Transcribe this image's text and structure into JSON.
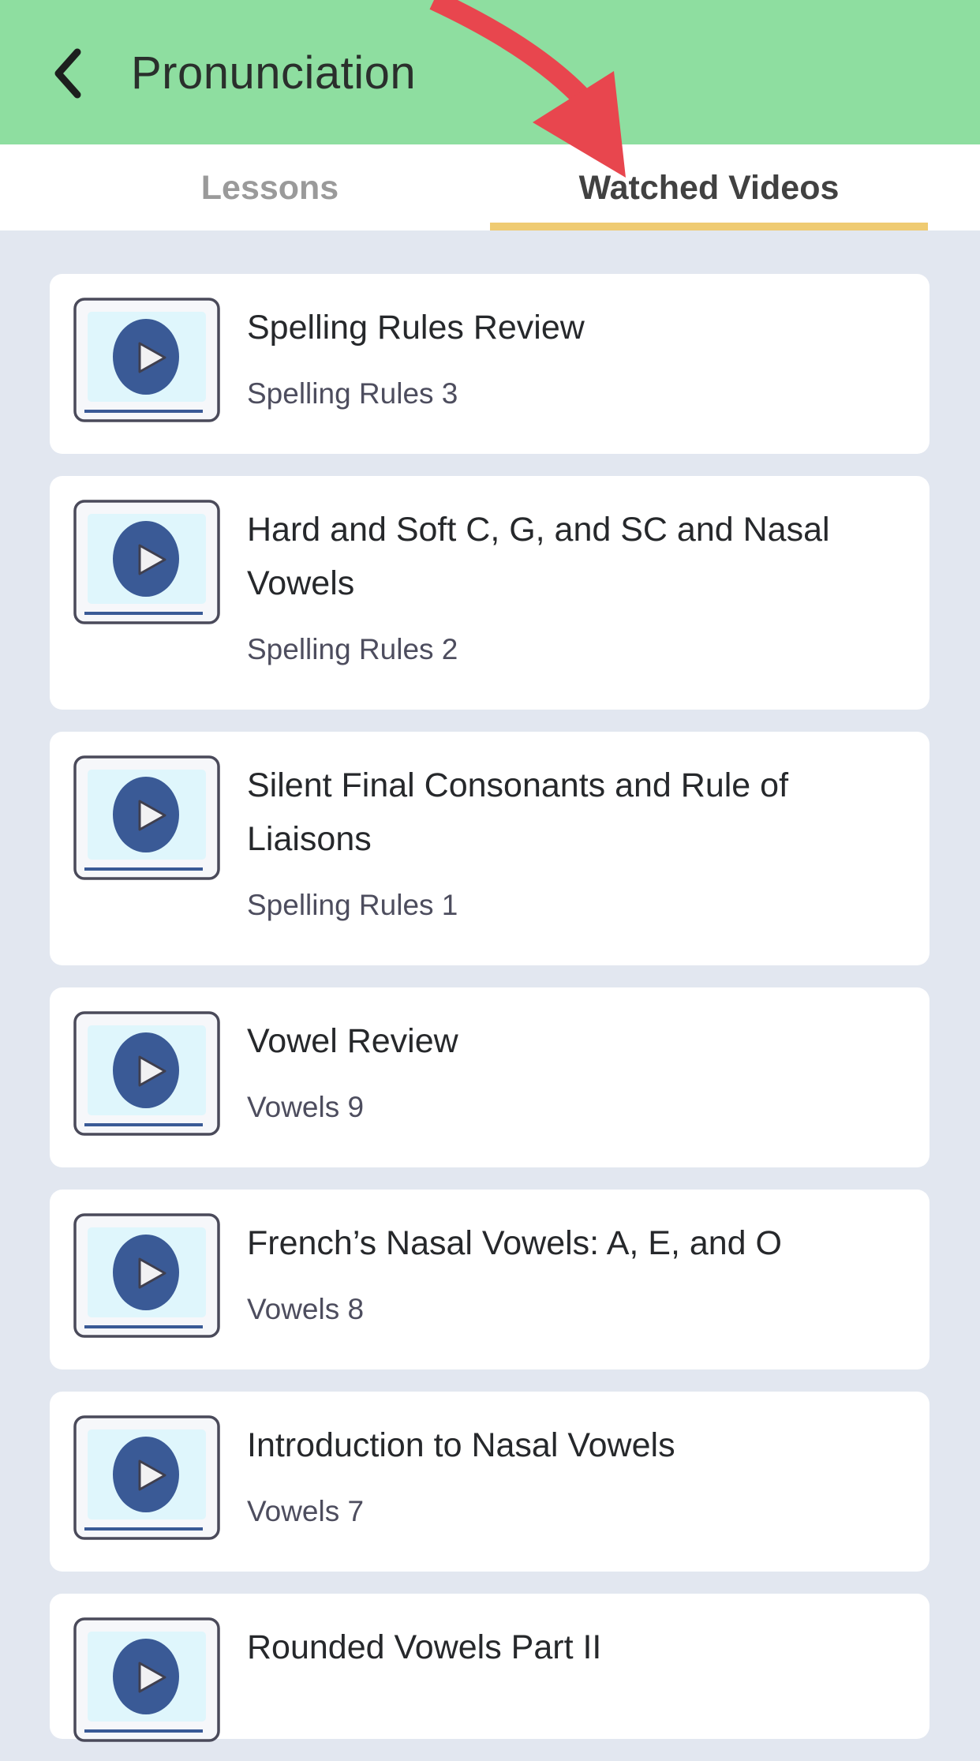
{
  "header": {
    "title": "Pronunciation",
    "back_icon": "chevron-left-icon",
    "background": "#8edea0"
  },
  "tabs": [
    {
      "label": "Lessons",
      "active": false
    },
    {
      "label": "Watched Videos",
      "active": true
    }
  ],
  "accent_color": "#efcb72",
  "annotation": {
    "type": "arrow",
    "color": "#e8464e",
    "points_to": "Watched Videos"
  },
  "videos": [
    {
      "title": "Spelling Rules Review",
      "subtitle": "Spelling Rules 3"
    },
    {
      "title": "Hard and Soft C, G, and SC and Nasal Vowels",
      "subtitle": "Spelling Rules 2"
    },
    {
      "title": "Silent Final Consonants and Rule of Liaisons",
      "subtitle": "Spelling Rules 1"
    },
    {
      "title": "Vowel Review",
      "subtitle": "Vowels 9"
    },
    {
      "title": "French’s Nasal Vowels: A, E, and O",
      "subtitle": "Vowels 8"
    },
    {
      "title": "Introduction to Nasal Vowels",
      "subtitle": "Vowels 7"
    },
    {
      "title": "Rounded Vowels Part II",
      "subtitle": ""
    }
  ]
}
